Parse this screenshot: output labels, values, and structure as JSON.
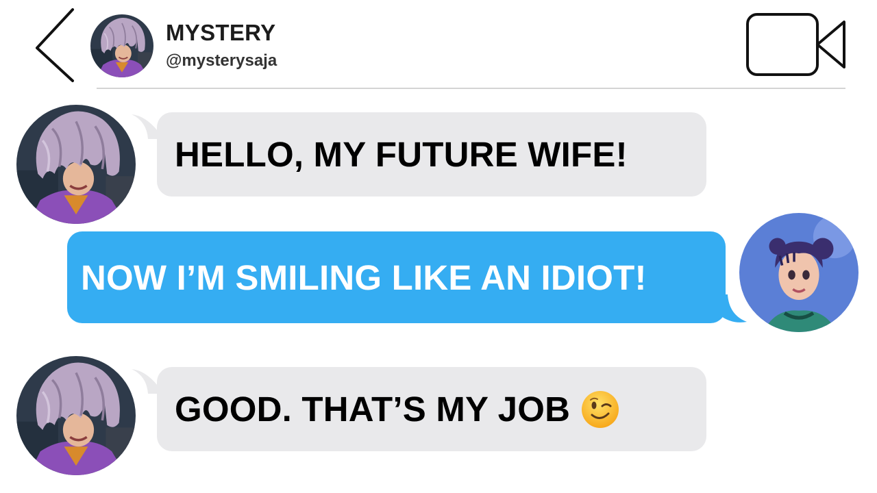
{
  "header": {
    "back_icon": "chevron-left-icon",
    "contact_name": "MYSTERY",
    "contact_handle": "@mysterysaja",
    "video_icon": "video-camera-icon"
  },
  "colors": {
    "sent_bubble": "#35adf2",
    "received_bubble": "#e9e9eb",
    "divider": "#d4d4d4",
    "icon_stroke": "#111111"
  },
  "messages": [
    {
      "direction": "received",
      "sender_avatar": "mystery-avatar",
      "text": "HELLO, MY FUTURE WIFE!"
    },
    {
      "direction": "sent",
      "sender_avatar": "user-avatar",
      "text": "NOW I’M SMILING LIKE AN IDIOT!"
    },
    {
      "direction": "received",
      "sender_avatar": "mystery-avatar",
      "text": "GOOD. THAT’S MY JOB",
      "emoji": "winking-face-emoji"
    }
  ]
}
